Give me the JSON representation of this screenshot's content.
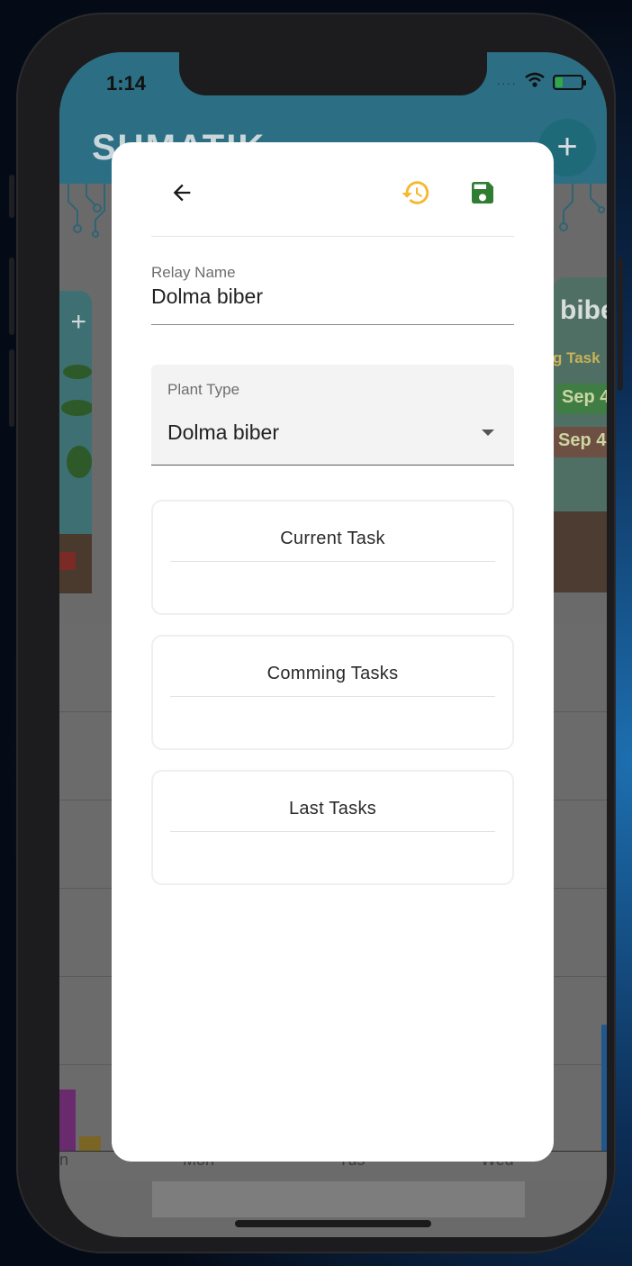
{
  "status_bar": {
    "time": "1:14",
    "battery_level": 0.3,
    "signal_dots": "····"
  },
  "background_app": {
    "title": "SUMATIK",
    "fab_label": "+",
    "left_card_plus": "+",
    "right_card": {
      "name_fragment": "bibe",
      "tag_fragment": "g Task",
      "chip1": "Sep 4",
      "chip2": "Sep 4"
    },
    "chart_axis": [
      "n",
      "Mon",
      "Tus",
      "Wed"
    ]
  },
  "dialog": {
    "toolbar": {
      "back_icon": "arrow-left-icon",
      "history_icon": "history-icon",
      "save_icon": "save-icon",
      "history_color": "#F5B82E",
      "save_color": "#2E7D32"
    },
    "relay_name": {
      "label": "Relay Name",
      "value": "Dolma biber"
    },
    "plant_type": {
      "label": "Plant Type",
      "selected": "Dolma biber"
    },
    "sections": [
      {
        "title": "Current Task"
      },
      {
        "title": "Comming Tasks"
      },
      {
        "title": "Last Tasks"
      }
    ]
  }
}
